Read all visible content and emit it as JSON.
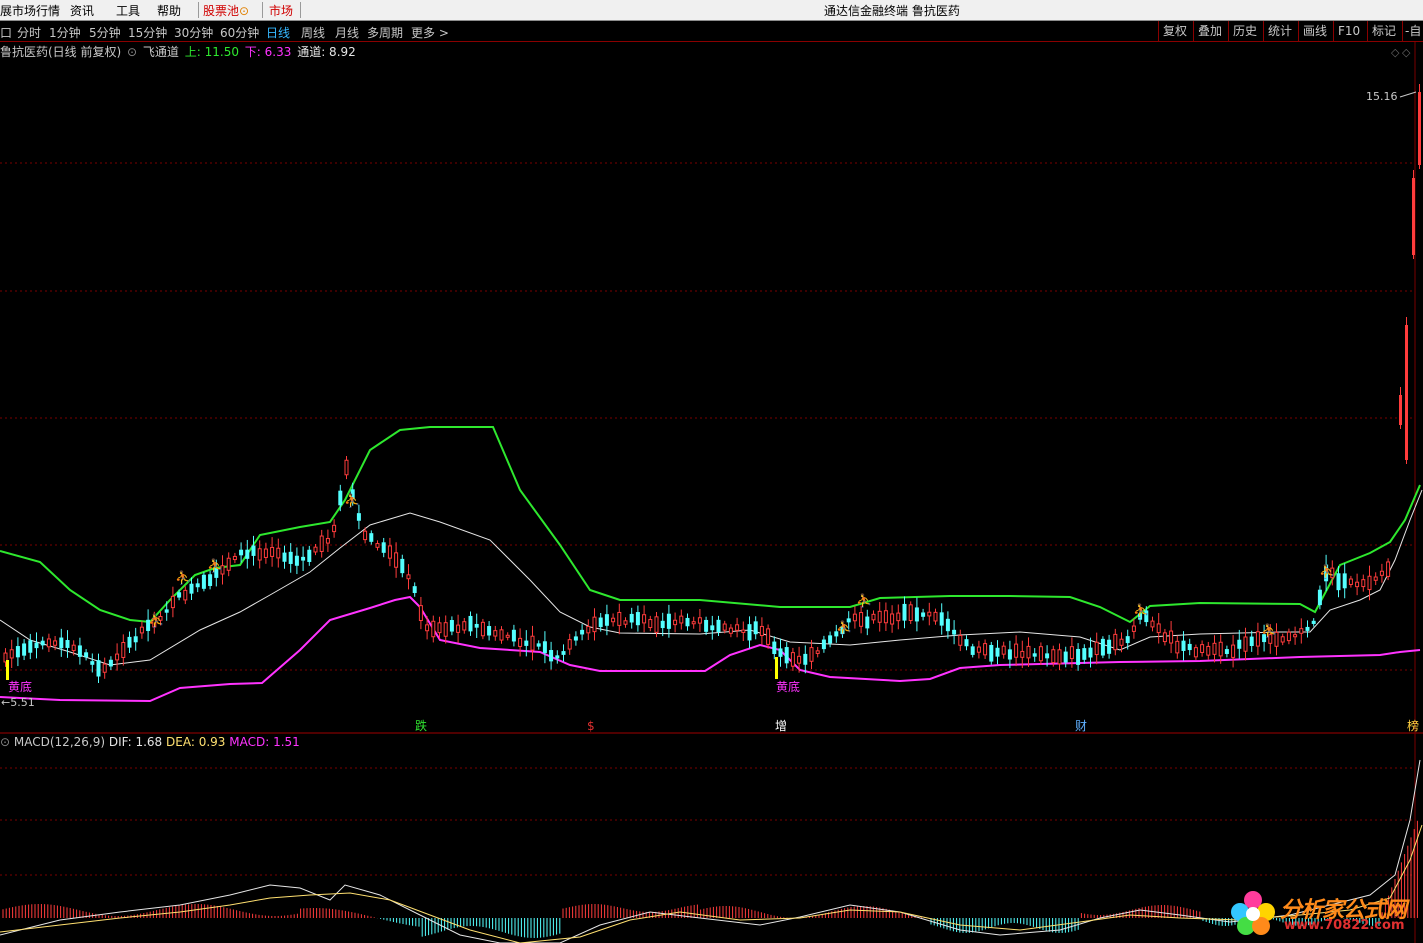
{
  "menubar": {
    "items": [
      "展市场行情",
      "资讯",
      "工具",
      "帮助"
    ],
    "stock_pool": "股票池",
    "market": "市场",
    "window_title": "通达信金融终端 鲁抗医药"
  },
  "toolbar": {
    "left_box": "口",
    "periods": [
      "分时",
      "1分钟",
      "5分钟",
      "15分钟",
      "30分钟",
      "60分钟",
      "日线",
      "周线",
      "月线",
      "多周期",
      "更多 >"
    ],
    "active_period": "日线",
    "right_buttons": [
      "复权",
      "叠加",
      "历史",
      "统计",
      "画线",
      "F10",
      "标记",
      "-自"
    ]
  },
  "main_legend": {
    "title": "鲁抗医药(日线 前复权)",
    "indicator": "飞通道",
    "upper_label": "上: 11.50",
    "lower_label": "下: 6.33",
    "channel_label": "通道: 8.92"
  },
  "macd_legend": {
    "title": "MACD(12,26,9)",
    "dif": "DIF: 1.68",
    "dea": "DEA: 0.93",
    "macd": "MACD: 1.51"
  },
  "price_labels": {
    "high": "15.16",
    "low": "←5.51"
  },
  "signals": {
    "bottom": [
      "黄底",
      "黄底"
    ],
    "bottom_markers": [
      {
        "text": "跌",
        "color": "#30e030"
      },
      {
        "text": "$",
        "color": "#e03030"
      },
      {
        "text": "增",
        "color": "#ffffff"
      },
      {
        "text": "财",
        "color": "#60b0ff"
      },
      {
        "text": "榜",
        "color": "#ffd040"
      }
    ]
  },
  "watermark": {
    "text": "分析家公式网",
    "url": "www.70822.com"
  },
  "colors": {
    "up": "#ff3c3c",
    "down": "#54ffff",
    "upper_band": "#2ee82e",
    "middle_line": "#e6e6e6",
    "lower_band": "#ff33ff",
    "grid": "#7a0000",
    "signal": "#ffa040"
  }
}
